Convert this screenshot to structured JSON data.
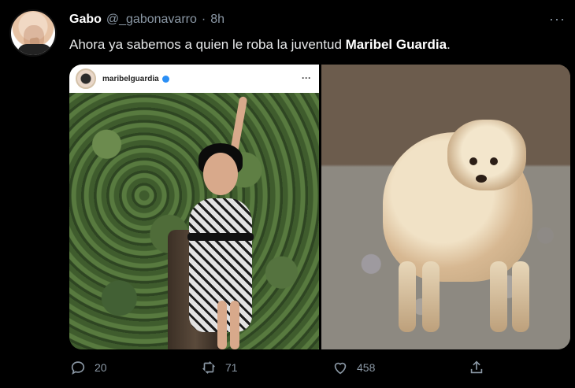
{
  "tweet": {
    "author": {
      "name": "Gabo",
      "handle": "@_gabonavarro",
      "separator": "·",
      "time": "8h"
    },
    "more_label": "···",
    "text": {
      "prefix": "Ahora ya sabemos a quien le roba la juventud ",
      "bold": "Maribel Guardia",
      "suffix": "."
    },
    "media": {
      "left": {
        "ig_username": "maribelguardia",
        "ig_more": "···"
      }
    },
    "actions": {
      "reply": {
        "icon": "reply-icon",
        "count": "20"
      },
      "retweet": {
        "icon": "retweet-icon",
        "count": "71"
      },
      "like": {
        "icon": "heart-icon",
        "count": "458"
      },
      "share": {
        "icon": "share-icon"
      }
    }
  }
}
